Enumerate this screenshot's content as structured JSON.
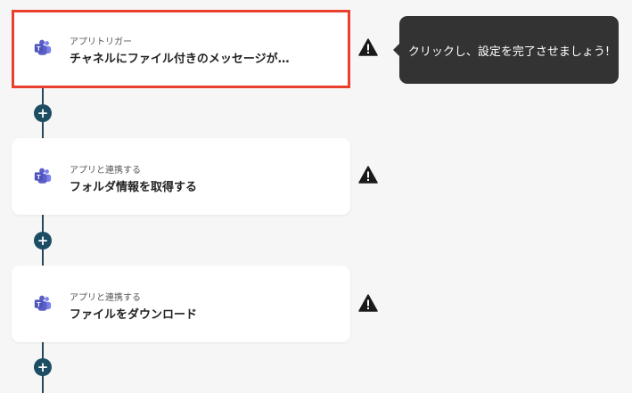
{
  "colors": {
    "background": "#f6f6f6",
    "card": "#ffffff",
    "highlight_border": "#e8402c",
    "connector": "#1d4d63",
    "tooltip_bg": "#333333",
    "teams_purple": "#5b5fc7"
  },
  "steps": [
    {
      "subtitle": "アプリトリガー",
      "title": "チャネルにファイル付きのメッセージが…",
      "icon": "microsoft-teams-icon",
      "highlighted": true,
      "warning": true
    },
    {
      "subtitle": "アプリと連携する",
      "title": "フォルダ情報を取得する",
      "icon": "microsoft-teams-icon",
      "highlighted": false,
      "warning": true
    },
    {
      "subtitle": "アプリと連携する",
      "title": "ファイルをダウンロード",
      "icon": "microsoft-teams-icon",
      "highlighted": false,
      "warning": true
    }
  ],
  "add_button_label": "+",
  "tooltip": {
    "text": "クリックし、設定を完了させましょう!"
  }
}
